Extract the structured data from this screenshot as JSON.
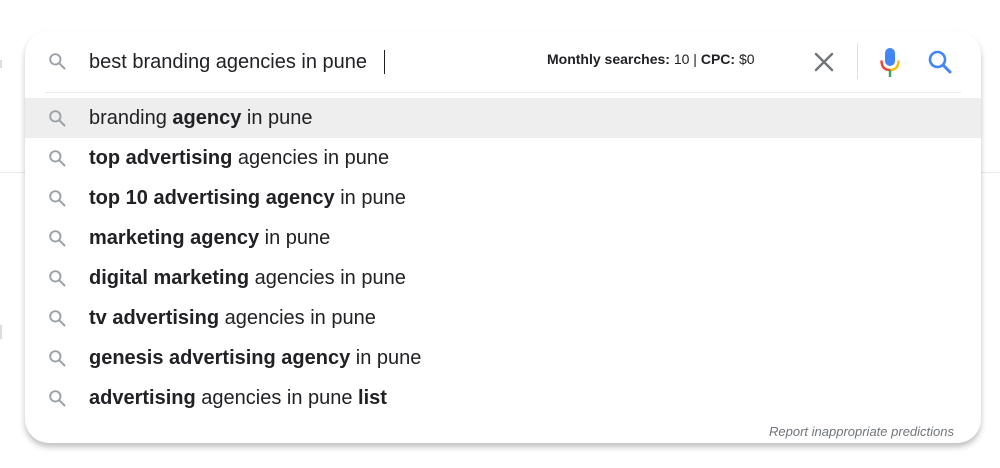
{
  "search": {
    "query": "best branding agencies in pune",
    "metrics_label_searches": "Monthly searches:",
    "metrics_value_searches": "10",
    "metrics_divider": "|",
    "metrics_label_cpc": "CPC:",
    "metrics_value_cpc": "$0"
  },
  "icons": {
    "search": "search-icon",
    "clear": "close-icon",
    "mic": "microphone-icon",
    "submit": "search-icon"
  },
  "colors": {
    "text": "#202124",
    "muted": "#70757a",
    "icon_grey": "#9aa0a6",
    "google_blue": "#4285f4",
    "google_red": "#ea4335",
    "google_yellow": "#fbbc04",
    "google_green": "#34a853",
    "hover_bg": "#eeeeee"
  },
  "suggestions": [
    {
      "segments": [
        {
          "text": "branding ",
          "bold": false
        },
        {
          "text": "agency",
          "bold": true
        },
        {
          "text": " in pune",
          "bold": false
        }
      ]
    },
    {
      "segments": [
        {
          "text": "top advertising",
          "bold": true
        },
        {
          "text": " agencies in pune",
          "bold": false
        }
      ]
    },
    {
      "segments": [
        {
          "text": "top 10 advertising agency",
          "bold": true
        },
        {
          "text": " in pune",
          "bold": false
        }
      ]
    },
    {
      "segments": [
        {
          "text": "marketing agency",
          "bold": true
        },
        {
          "text": " in pune",
          "bold": false
        }
      ]
    },
    {
      "segments": [
        {
          "text": "digital marketing",
          "bold": true
        },
        {
          "text": " agencies in pune",
          "bold": false
        }
      ]
    },
    {
      "segments": [
        {
          "text": "tv advertising",
          "bold": true
        },
        {
          "text": " agencies in pune",
          "bold": false
        }
      ]
    },
    {
      "segments": [
        {
          "text": "genesis advertising agency",
          "bold": true
        },
        {
          "text": " in pune",
          "bold": false
        }
      ]
    },
    {
      "segments": [
        {
          "text": "advertising",
          "bold": true
        },
        {
          "text": " agencies in pune ",
          "bold": false
        },
        {
          "text": "list",
          "bold": true
        }
      ]
    }
  ],
  "footer": {
    "report_label": "Report inappropriate predictions"
  }
}
